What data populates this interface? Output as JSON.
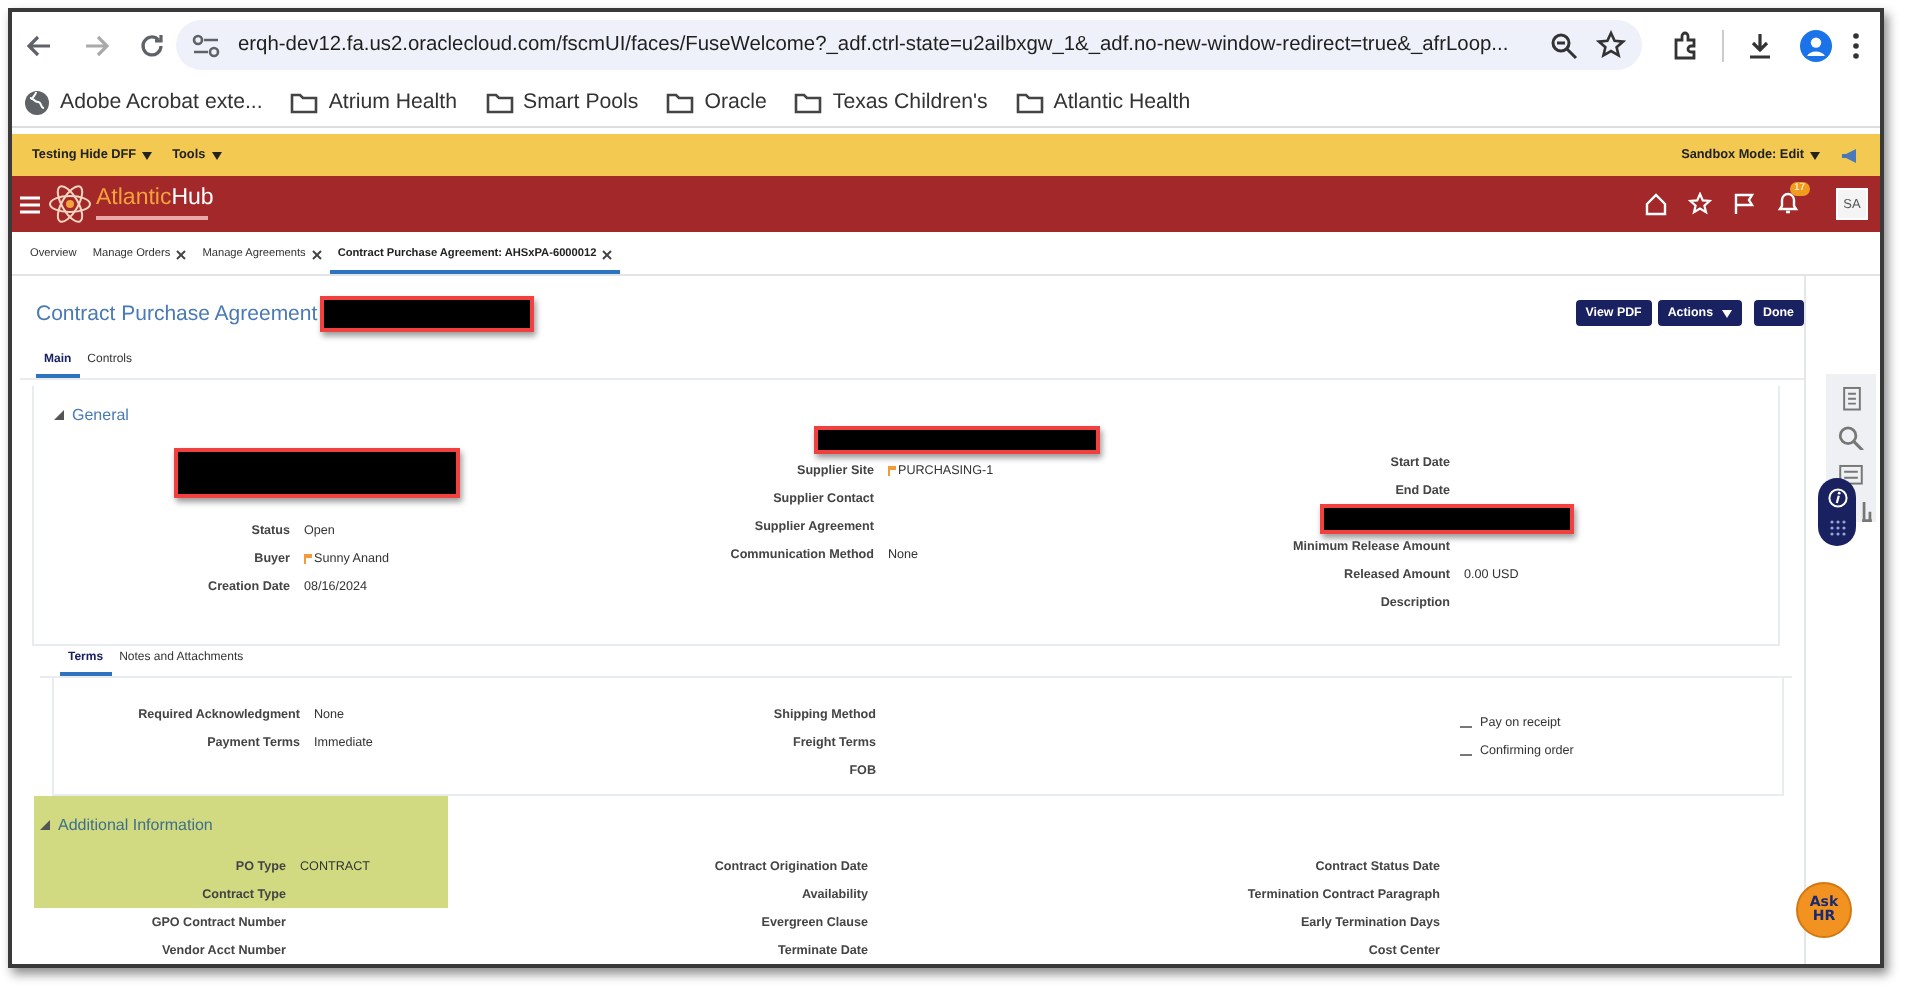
{
  "browser": {
    "url": "erqh-dev12.fa.us2.oraclecloud.com/fscmUI/faces/FuseWelcome?_adf.ctrl-state=u2ailbxgw_1&_adf.no-new-window-redirect=true&_afrLoop...",
    "bookmarks": [
      {
        "kind": "app",
        "label": "Adobe Acrobat exte..."
      },
      {
        "kind": "folder",
        "label": "Atrium Health"
      },
      {
        "kind": "folder",
        "label": "Smart Pools"
      },
      {
        "kind": "folder",
        "label": "Oracle"
      },
      {
        "kind": "folder",
        "label": "Texas Children's"
      },
      {
        "kind": "folder",
        "label": "Atlantic Health"
      }
    ]
  },
  "sandbox_bar": {
    "menus": [
      "Testing Hide DFF",
      "Tools"
    ],
    "mode": "Sandbox Mode: Edit"
  },
  "header": {
    "logo": [
      "Atlantic",
      "Hub"
    ],
    "notification_count": "17",
    "avatar": "SA"
  },
  "page_tabs": [
    {
      "label": "Overview",
      "closable": false,
      "selected": false
    },
    {
      "label": "Manage Orders",
      "closable": true,
      "selected": false
    },
    {
      "label": "Manage Agreements",
      "closable": true,
      "selected": false
    },
    {
      "label": "Contract Purchase Agreement: AHSxPA-6000012",
      "closable": true,
      "selected": true
    }
  ],
  "page": {
    "title": "Contract Purchase Agreement",
    "buttons": [
      {
        "label": "View PDF",
        "menu": false
      },
      {
        "label": "Actions",
        "menu": true
      },
      {
        "label": "Done",
        "menu": false
      }
    ],
    "tabs": [
      {
        "label": "Main",
        "selected": true
      },
      {
        "label": "Controls",
        "selected": false
      }
    ]
  },
  "general": {
    "title": "General",
    "expanded": true,
    "columns": [
      [
        {
          "kind": "redacted"
        },
        {
          "kind": "field",
          "label": "Status",
          "value": "Open",
          "flag": false
        },
        {
          "kind": "field",
          "label": "Buyer",
          "value": "Sunny Anand",
          "flag": true
        },
        {
          "kind": "field",
          "label": "Creation Date",
          "value": "08/16/2024",
          "flag": false
        }
      ],
      [
        {
          "kind": "redacted"
        },
        {
          "kind": "field",
          "label": "Supplier Site",
          "value": "PURCHASING-1",
          "flag": true
        },
        {
          "kind": "field",
          "label": "Supplier Contact",
          "flag": false
        },
        {
          "kind": "field",
          "label": "Supplier Agreement",
          "flag": false
        },
        {
          "kind": "field",
          "label": "Communication Method",
          "value": "None",
          "flag": false
        }
      ],
      [
        {
          "kind": "field",
          "label": "Start Date",
          "flag": false
        },
        {
          "kind": "field",
          "label": "End Date",
          "flag": false
        },
        {
          "kind": "redacted"
        },
        {
          "kind": "field",
          "label": "Minimum Release Amount",
          "flag": false
        },
        {
          "kind": "field",
          "label": "Released Amount",
          "value": "0.00 USD",
          "flag": false
        },
        {
          "kind": "field",
          "label": "Description",
          "flag": false
        }
      ]
    ]
  },
  "terms": {
    "tabs": [
      {
        "label": "Terms",
        "selected": true
      },
      {
        "label": "Notes and Attachments",
        "selected": false
      }
    ],
    "columns": [
      [
        {
          "kind": "field",
          "label": "Required Acknowledgment",
          "value": "None",
          "flag": false
        },
        {
          "kind": "field",
          "label": "Payment Terms",
          "value": "Immediate",
          "flag": false
        }
      ],
      [
        {
          "kind": "field",
          "label": "Shipping Method",
          "flag": false
        },
        {
          "kind": "field",
          "label": "Freight Terms",
          "flag": false
        },
        {
          "kind": "field",
          "label": "FOB",
          "flag": false
        }
      ],
      [
        {
          "kind": "checkbox",
          "label": "Pay on receipt",
          "checked": false
        },
        {
          "kind": "checkbox",
          "label": "Confirming order",
          "checked": false
        }
      ]
    ]
  },
  "additional": {
    "title": "Additional Information",
    "expanded": true,
    "columns": [
      [
        {
          "kind": "field",
          "label": "PO Type",
          "value": "CONTRACT",
          "flag": false
        },
        {
          "kind": "field",
          "label": "Contract Type",
          "flag": false
        },
        {
          "kind": "field",
          "label": "GPO Contract Number",
          "flag": false
        },
        {
          "kind": "field",
          "label": "Vendor Acct Number",
          "flag": false
        }
      ],
      [
        {
          "kind": "field",
          "label": "Contract Origination Date",
          "flag": false
        },
        {
          "kind": "field",
          "label": "Availability",
          "flag": false
        },
        {
          "kind": "field",
          "label": "Evergreen Clause",
          "flag": false
        },
        {
          "kind": "field",
          "label": "Terminate Date",
          "flag": false
        }
      ],
      [
        {
          "kind": "field",
          "label": "Contract Status Date",
          "flag": false
        },
        {
          "kind": "field",
          "label": "Termination Contract Paragraph",
          "flag": false
        },
        {
          "kind": "field",
          "label": "Early Termination Days",
          "flag": false
        },
        {
          "kind": "field",
          "label": "Cost Center",
          "flag": false
        }
      ]
    ]
  },
  "ask_hr": {
    "top": "Ask",
    "bottom": "HR"
  }
}
